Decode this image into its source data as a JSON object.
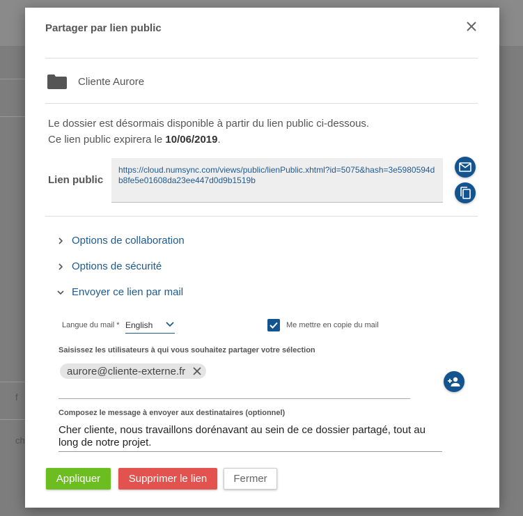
{
  "background": {
    "fragments": [
      "f",
      "ch"
    ]
  },
  "dialog": {
    "title": "Partager par lien public",
    "folder_name": "Cliente Aurore",
    "info_line1": "Le dossier est désormais disponible à partir du lien public ci-dessous.",
    "info_line2_prefix": "Ce lien public expirera le ",
    "expiry_date": "10/06/2019",
    "info_line2_suffix": ".",
    "public_link_label": "Lien public",
    "public_link_url": "https://cloud.numsync.com/views/public/lienPublic.xhtml?id=5075&hash=3e5980594db8fe5e01608da23ee447d0d9b1519b"
  },
  "accordion": [
    {
      "label": "Options de collaboration",
      "expanded": false
    },
    {
      "label": "Options de sécurité",
      "expanded": false
    },
    {
      "label": "Envoyer ce lien par mail",
      "expanded": true
    }
  ],
  "mail": {
    "language_label": "Langue du mail",
    "required_mark": "*",
    "language_value": "English",
    "copy_me_label": "Me mettre en copie du mail",
    "copy_me_checked": true,
    "users_label": "Saisissez les utilisateurs à qui vous souhaitez partager votre sélection",
    "recipients": [
      "aurore@cliente-externe.fr"
    ],
    "message_label": "Composez le message à envoyer aux destinataires (optionnel)",
    "message_value": "Cher cliente, nous travaillons dorénavant au sein de ce dossier partagé, tout au long de notre projet."
  },
  "buttons": {
    "apply": "Appliquer",
    "delete": "Supprimer le lien",
    "close": "Fermer"
  },
  "colors": {
    "primary": "#13548e",
    "link": "#1f5a8f",
    "apply": "#6cbd1f",
    "delete": "#e2524f"
  },
  "icons": {
    "close": "close-icon",
    "folder": "folder-icon",
    "mail": "mail-icon",
    "copy": "copy-icon",
    "chevron_right": "chevron-right-icon",
    "chevron_down": "chevron-down-icon",
    "check": "check-icon",
    "chip_remove": "close-icon",
    "add_user": "add-user-icon"
  }
}
